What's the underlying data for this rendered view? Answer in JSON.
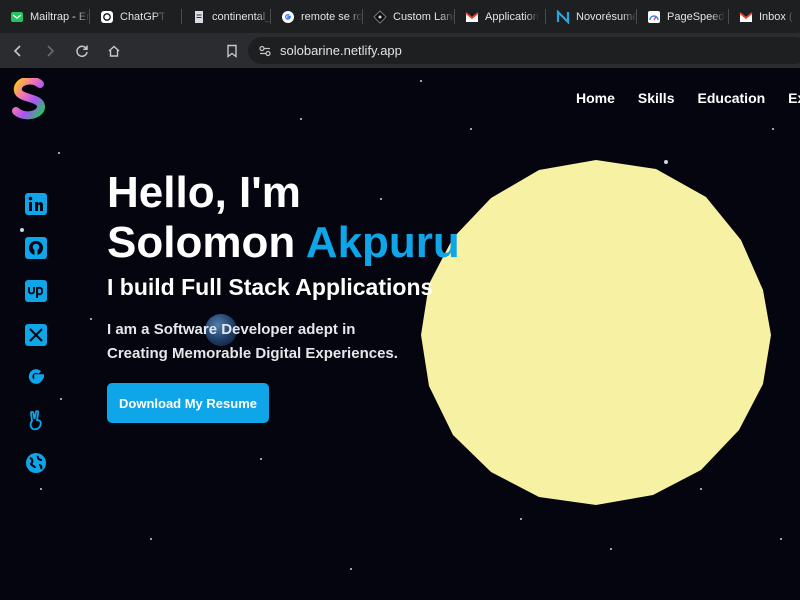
{
  "browser": {
    "tabs": [
      {
        "title": "Mailtrap - Em",
        "icon": "mailtrap-icon",
        "width": 90
      },
      {
        "title": "ChatGPT",
        "icon": "chatgpt-icon",
        "width": 92
      },
      {
        "title": "continental_",
        "icon": "document-icon",
        "width": 89
      },
      {
        "title": "remote se ro",
        "icon": "google-icon",
        "width": 92
      },
      {
        "title": "Custom Land",
        "icon": "figma-icon",
        "width": 92
      },
      {
        "title": "Application",
        "icon": "gmail-icon",
        "width": 91
      },
      {
        "title": "Novorésumé",
        "icon": "novoresume-icon",
        "width": 91
      },
      {
        "title": "PageSpeed",
        "icon": "pagespeed-icon",
        "width": 92
      },
      {
        "title": "Inbox (",
        "icon": "gmail-icon",
        "width": 80
      }
    ],
    "url": "solobarine.netlify.app"
  },
  "site": {
    "nav": [
      "Home",
      "Skills",
      "Education",
      "Exp"
    ],
    "hero": {
      "greeting": "Hello, I'm",
      "first_name": "Solomon",
      "last_name": "Akpuru",
      "subtitle": "I build Full Stack Applications",
      "desc_line1": "I am a Software Developer adept in",
      "desc_line2": "Creating Memorable Digital Experiences.",
      "button": "Download My Resume"
    },
    "social": [
      "linkedin-icon",
      "github-icon",
      "upwork-icon",
      "x-twitter-icon",
      "google-icon",
      "peace-hand-icon",
      "globe-icon"
    ],
    "colors": {
      "accent": "#0ea5e9",
      "moon": "#f7f1a3",
      "background": "#05050f"
    }
  }
}
